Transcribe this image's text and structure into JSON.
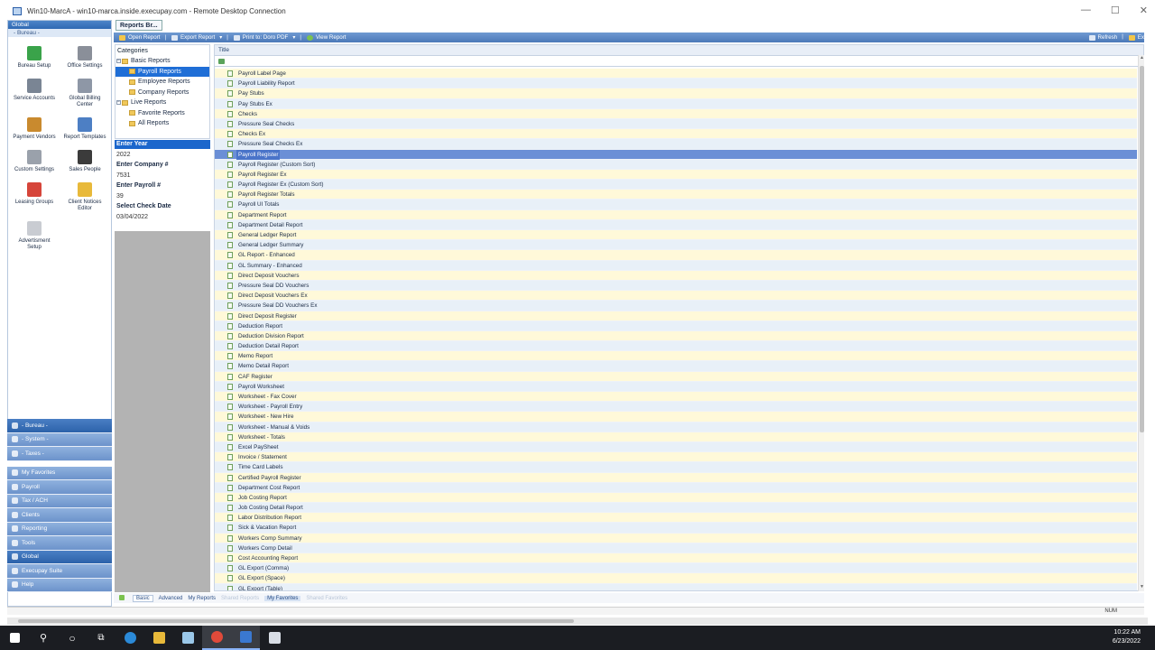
{
  "rdp": {
    "title": "Win10-MarcA - win10-marca.inside.execupay.com - Remote Desktop Connection"
  },
  "nav": {
    "header": "Global",
    "section": "- Bureau -",
    "tools": [
      {
        "label": "Bureau Setup",
        "icon": "bureau-setup-icon",
        "color": "#3aa34a"
      },
      {
        "label": "Office Settings",
        "icon": "office-settings-icon",
        "color": "#8a8f99"
      },
      {
        "label": "Service Accounts",
        "icon": "service-accounts-icon",
        "color": "#7a8594"
      },
      {
        "label": "Global Billing Center",
        "icon": "billing-center-icon",
        "color": "#8e97a6"
      },
      {
        "label": "Payment Vendors",
        "icon": "payment-vendors-icon",
        "color": "#c98a2e"
      },
      {
        "label": "Report Templates",
        "icon": "report-templates-icon",
        "color": "#4d7fc4"
      },
      {
        "label": "Custom Settings",
        "icon": "custom-settings-icon",
        "color": "#9aa1ab"
      },
      {
        "label": "Sales People",
        "icon": "sales-people-icon",
        "color": "#3b3b3b"
      },
      {
        "label": "Leasing Groups",
        "icon": "leasing-groups-icon",
        "color": "#d6453a"
      },
      {
        "label": "Client Notices Editor",
        "icon": "client-notices-icon",
        "color": "#e8b93a"
      },
      {
        "label": "Advertisment Setup",
        "icon": "advertisment-setup-icon",
        "color": "#c9ccd2"
      }
    ],
    "panes_top": [
      "- Bureau -",
      "- System -",
      "- Taxes -"
    ],
    "panes": [
      "My Favorites",
      "Payroll",
      "Tax / ACH",
      "Clients",
      "Reporting",
      "Tools",
      "Global",
      "Execupay Suite",
      "Help"
    ]
  },
  "toolbar": {
    "tab": "Reports Br...",
    "open": "Open Report",
    "export": "Export Report",
    "print": "Print to: Doro PDF",
    "view": "View Report",
    "refresh": "Refresh",
    "exit": "Ex"
  },
  "categories": {
    "title": "Categories",
    "basic": "Basic Reports",
    "payroll": "Payroll Reports",
    "employee": "Employee Reports",
    "company": "Company Reports",
    "live": "Live Reports",
    "favorite": "Favorite Reports",
    "all": "All Reports"
  },
  "params": {
    "year_label": "Enter Year",
    "year": "2022",
    "company_label": "Enter Company #",
    "company": "7531",
    "payroll_label": "Enter Payroll #",
    "payroll": "39",
    "date_label": "Select Check Date",
    "date": "03/04/2022"
  },
  "list": {
    "column": "Title",
    "selected_index": 8,
    "reports": [
      "Payroll Label Page",
      "Payroll Liability Report",
      "Pay Stubs",
      "Pay Stubs Ex",
      "Checks",
      "Pressure Seal Checks",
      "Checks Ex",
      "Pressure Seal Checks Ex",
      "Payroll Register",
      "Payroll Register (Custom Sort)",
      "Payroll Register Ex",
      "Payroll Register Ex (Custom Sort)",
      "Payroll Register Totals",
      "Payroll UI Totals",
      "Department Report",
      "Department Detail Report",
      "General Ledger Report",
      "General Ledger Summary",
      "GL Report - Enhanced",
      "GL Summary - Enhanced",
      "Direct Deposit Vouchers",
      "Pressure Seal DD Vouchers",
      "Direct Deposit Vouchers Ex",
      "Pressure Seal DD Vouchers Ex",
      "Direct Deposit Register",
      "Deduction Report",
      "Deduction Division Report",
      "Deduction Detail Report",
      "Memo Report",
      "Memo Detail Report",
      "CAF Register",
      "Payroll Worksheet",
      "Worksheet - Fax Cover",
      "Worksheet - Payroll Entry",
      "Worksheet - New Hire",
      "Worksheet - Manual & Voids",
      "Worksheet - Totals",
      "Excel PaySheet",
      "Invoice / Statement",
      "Time Card Labels",
      "Certified Payroll Register",
      "Department Cost Report",
      "Job Costing Report",
      "Job Costing Detail Report",
      "Labor Distribution Report",
      "Sick & Vacation Report",
      "Workers Comp Summary",
      "Workers Comp Detail",
      "Cost Accounting Report",
      "GL Export (Comma)",
      "GL Export (Space)",
      "GL Export (Table)"
    ]
  },
  "bottom_tabs": {
    "basic": "Basic",
    "advanced": "Advanced",
    "my_reports": "My Reports",
    "shared": "Shared Reports",
    "my_fav": "My Favorites",
    "shared_fav": "Shared Favorites"
  },
  "status": {
    "num": "NUM"
  },
  "clock": {
    "time": "10:22 AM",
    "date": "6/23/2022"
  }
}
